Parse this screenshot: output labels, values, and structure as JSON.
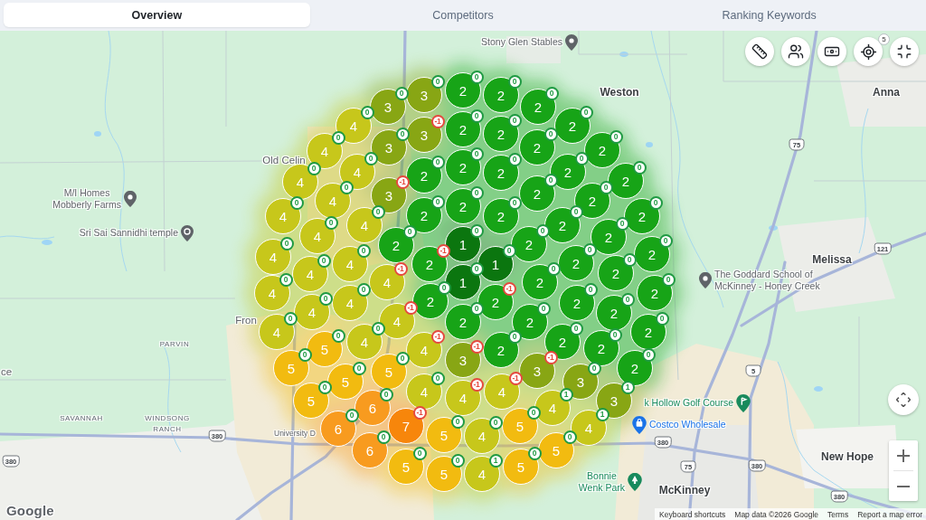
{
  "tabs": [
    {
      "label": "Overview",
      "selected": true
    },
    {
      "label": "Competitors",
      "selected": false
    },
    {
      "label": "Ranking Keywords",
      "selected": false
    }
  ],
  "map_toolbar": {
    "locate_count": "5"
  },
  "map": {
    "places": [
      {
        "text": "Weston",
        "kind": "city"
      },
      {
        "text": "Anna",
        "kind": "city"
      },
      {
        "text": "Old Celin",
        "kind": "locality"
      },
      {
        "text": "Melissa",
        "kind": "city"
      },
      {
        "text": "Fron",
        "kind": "locality"
      },
      {
        "text": "ce",
        "kind": "locality"
      },
      {
        "text": "New Hope",
        "kind": "city"
      },
      {
        "text": "McKinney",
        "kind": "city"
      }
    ],
    "points_of_interest": [
      {
        "lines": [
          "Stony Glen Stables"
        ],
        "color": "#5f6368"
      },
      {
        "lines": [
          "M/I Homes",
          "Mobberly Farms"
        ],
        "color": "#5f6368"
      },
      {
        "lines": [
          "Sri Sai Sannidhi temple"
        ],
        "color": "#5f6368"
      },
      {
        "lines": [
          "The Goddard School of",
          "McKinney - Honey Creek"
        ],
        "color": "#5f6368"
      },
      {
        "lines": [
          "k Hollow Golf Course"
        ],
        "color": "#188a5c"
      },
      {
        "lines": [
          "Costco Wholesale"
        ],
        "color": "#1a73e8"
      },
      {
        "lines": [
          "Bonnie",
          "Wenk Park"
        ],
        "color": "#188a5c"
      }
    ],
    "districts": [
      {
        "lines": [
          "PARVIN"
        ]
      },
      {
        "lines": [
          "SAVANNAH"
        ]
      },
      {
        "lines": [
          "WINDSONG",
          "RANCH"
        ]
      }
    ],
    "road_labels": [
      "University D"
    ],
    "road_shields": [
      "75",
      "121",
      "5",
      "380",
      "380",
      "380",
      "380",
      "75",
      "380"
    ],
    "markers": [
      {
        "rank": "3",
        "color": "#88a614",
        "change": {
          "value": "0",
          "kind": "flat"
        }
      },
      {
        "rank": "3",
        "color": "#88a614",
        "change": {
          "value": "0",
          "kind": "flat"
        }
      },
      {
        "rank": "2",
        "color": "#17a417",
        "change": {
          "value": "0",
          "kind": "flat"
        }
      },
      {
        "rank": "2",
        "color": "#17a417",
        "change": {
          "value": "0",
          "kind": "flat"
        }
      },
      {
        "rank": "2",
        "color": "#17a417",
        "change": {
          "value": "0",
          "kind": "flat"
        }
      },
      {
        "rank": "4",
        "color": "#c7c71b",
        "change": {
          "value": "0",
          "kind": "flat"
        }
      },
      {
        "rank": "3",
        "color": "#88a614",
        "change": {
          "value": "-1",
          "kind": "down"
        }
      },
      {
        "rank": "2",
        "color": "#17a417",
        "change": {
          "value": "0",
          "kind": "flat"
        }
      },
      {
        "rank": "2",
        "color": "#17a417",
        "change": {
          "value": "0",
          "kind": "flat"
        }
      },
      {
        "rank": "2",
        "color": "#17a417",
        "change": {
          "value": "0",
          "kind": "flat"
        }
      },
      {
        "rank": "4",
        "color": "#c7c71b",
        "change": {
          "value": "0",
          "kind": "flat"
        }
      },
      {
        "rank": "3",
        "color": "#88a614",
        "change": {
          "value": "0",
          "kind": "flat"
        }
      },
      {
        "rank": "2",
        "color": "#17a417",
        "change": {
          "value": "0",
          "kind": "flat"
        }
      },
      {
        "rank": "2",
        "color": "#17a417",
        "change": {
          "value": "0",
          "kind": "flat"
        }
      },
      {
        "rank": "4",
        "color": "#c7c71b",
        "change": {
          "value": "0",
          "kind": "flat"
        }
      },
      {
        "rank": "4",
        "color": "#c7c71b",
        "change": {
          "value": "0",
          "kind": "flat"
        }
      },
      {
        "rank": "2",
        "color": "#17a417",
        "change": {
          "value": "0",
          "kind": "flat"
        }
      },
      {
        "rank": "2",
        "color": "#17a417",
        "change": {
          "value": "0",
          "kind": "flat"
        }
      },
      {
        "rank": "2",
        "color": "#17a417",
        "change": {
          "value": "0",
          "kind": "flat"
        }
      },
      {
        "rank": "2",
        "color": "#17a417",
        "change": {
          "value": "0",
          "kind": "flat"
        }
      },
      {
        "rank": "2",
        "color": "#17a417",
        "change": {
          "value": "0",
          "kind": "flat"
        }
      },
      {
        "rank": "4",
        "color": "#c7c71b",
        "change": {
          "value": "0",
          "kind": "flat"
        }
      },
      {
        "rank": "4",
        "color": "#c7c71b",
        "change": {
          "value": "0",
          "kind": "flat"
        }
      },
      {
        "rank": "3",
        "color": "#88a614",
        "change": {
          "value": "-1",
          "kind": "down"
        }
      },
      {
        "rank": "2",
        "color": "#17a417",
        "change": {
          "value": "0",
          "kind": "flat"
        }
      },
      {
        "rank": "2",
        "color": "#17a417",
        "change": {
          "value": "0",
          "kind": "flat"
        }
      },
      {
        "rank": "2",
        "color": "#17a417",
        "change": {
          "value": "0",
          "kind": "flat"
        }
      },
      {
        "rank": "4",
        "color": "#c7c71b",
        "change": {
          "value": "0",
          "kind": "flat"
        }
      },
      {
        "rank": "2",
        "color": "#17a417",
        "change": {
          "value": "0",
          "kind": "flat"
        }
      },
      {
        "rank": "2",
        "color": "#17a417",
        "change": {
          "value": "0",
          "kind": "flat"
        }
      },
      {
        "rank": "2",
        "color": "#17a417",
        "change": {
          "value": "0",
          "kind": "flat"
        }
      },
      {
        "rank": "2",
        "color": "#17a417",
        "change": {
          "value": "0",
          "kind": "flat"
        }
      },
      {
        "rank": "4",
        "color": "#c7c71b",
        "change": {
          "value": "0",
          "kind": "flat"
        }
      },
      {
        "rank": "2",
        "color": "#17a417",
        "change": {
          "value": "0",
          "kind": "flat"
        }
      },
      {
        "rank": "1",
        "color": "#0b760f",
        "change": {
          "value": "0",
          "kind": "flat"
        }
      },
      {
        "rank": "2",
        "color": "#17a417",
        "change": {
          "value": "0",
          "kind": "flat"
        }
      },
      {
        "rank": "2",
        "color": "#17a417",
        "change": {
          "value": "0",
          "kind": "flat"
        }
      },
      {
        "rank": "4",
        "color": "#c7c71b",
        "change": {
          "value": "0",
          "kind": "flat"
        }
      },
      {
        "rank": "4",
        "color": "#c7c71b",
        "change": {
          "value": "0",
          "kind": "flat"
        }
      },
      {
        "rank": "2",
        "color": "#17a417",
        "change": {
          "value": "-1",
          "kind": "down"
        }
      },
      {
        "rank": "1",
        "color": "#0b760f",
        "change": {
          "value": "0",
          "kind": "flat"
        }
      },
      {
        "rank": "2",
        "color": "#17a417",
        "change": {
          "value": "0",
          "kind": "flat"
        }
      },
      {
        "rank": "2",
        "color": "#17a417",
        "change": {
          "value": "0",
          "kind": "flat"
        }
      },
      {
        "rank": "4",
        "color": "#c7c71b",
        "change": {
          "value": "0",
          "kind": "flat"
        }
      },
      {
        "rank": "4",
        "color": "#c7c71b",
        "change": {
          "value": "-1",
          "kind": "down"
        }
      },
      {
        "rank": "1",
        "color": "#0b760f",
        "change": {
          "value": "0",
          "kind": "flat"
        }
      },
      {
        "rank": "2",
        "color": "#17a417",
        "change": {
          "value": "0",
          "kind": "flat"
        }
      },
      {
        "rank": "2",
        "color": "#17a417",
        "change": {
          "value": "0",
          "kind": "flat"
        }
      },
      {
        "rank": "4",
        "color": "#c7c71b",
        "change": {
          "value": "0",
          "kind": "flat"
        }
      },
      {
        "rank": "4",
        "color": "#c7c71b",
        "change": {
          "value": "0",
          "kind": "flat"
        }
      },
      {
        "rank": "2",
        "color": "#17a417",
        "change": {
          "value": "0",
          "kind": "flat"
        }
      },
      {
        "rank": "2",
        "color": "#17a417",
        "change": {
          "value": "-1",
          "kind": "down"
        }
      },
      {
        "rank": "2",
        "color": "#17a417",
        "change": {
          "value": "0",
          "kind": "flat"
        }
      },
      {
        "rank": "2",
        "color": "#17a417",
        "change": {
          "value": "0",
          "kind": "flat"
        }
      },
      {
        "rank": "4",
        "color": "#c7c71b",
        "change": {
          "value": "0",
          "kind": "flat"
        }
      },
      {
        "rank": "4",
        "color": "#c7c71b",
        "change": {
          "value": "-1",
          "kind": "down"
        }
      },
      {
        "rank": "2",
        "color": "#17a417",
        "change": {
          "value": "0",
          "kind": "flat"
        }
      },
      {
        "rank": "2",
        "color": "#17a417",
        "change": {
          "value": "0",
          "kind": "flat"
        }
      },
      {
        "rank": "2",
        "color": "#17a417",
        "change": {
          "value": "0",
          "kind": "flat"
        }
      },
      {
        "rank": "4",
        "color": "#c7c71b",
        "change": {
          "value": "0",
          "kind": "flat"
        }
      },
      {
        "rank": "5",
        "color": "#f2bb10",
        "change": {
          "value": "0",
          "kind": "flat"
        }
      },
      {
        "rank": "4",
        "color": "#c7c71b",
        "change": {
          "value": "0",
          "kind": "flat"
        }
      },
      {
        "rank": "4",
        "color": "#c7c71b",
        "change": {
          "value": "-1",
          "kind": "down"
        }
      },
      {
        "rank": "2",
        "color": "#17a417",
        "change": {
          "value": "0",
          "kind": "flat"
        }
      },
      {
        "rank": "2",
        "color": "#17a417",
        "change": {
          "value": "0",
          "kind": "flat"
        }
      },
      {
        "rank": "2",
        "color": "#17a417",
        "change": {
          "value": "0",
          "kind": "flat"
        }
      },
      {
        "rank": "2",
        "color": "#17a417",
        "change": {
          "value": "0",
          "kind": "flat"
        }
      },
      {
        "rank": "5",
        "color": "#f2bb10",
        "change": {
          "value": "0",
          "kind": "flat"
        }
      },
      {
        "rank": "5",
        "color": "#f2bb10",
        "change": {
          "value": "0",
          "kind": "flat"
        }
      },
      {
        "rank": "5",
        "color": "#f2bb10",
        "change": {
          "value": "0",
          "kind": "flat"
        }
      },
      {
        "rank": "3",
        "color": "#88a614",
        "change": {
          "value": "-1",
          "kind": "down"
        }
      },
      {
        "rank": "3",
        "color": "#88a614",
        "change": {
          "value": "-1",
          "kind": "down"
        }
      },
      {
        "rank": "3",
        "color": "#88a614",
        "change": {
          "value": "0",
          "kind": "flat"
        }
      },
      {
        "rank": "2",
        "color": "#17a417",
        "change": {
          "value": "0",
          "kind": "flat"
        }
      },
      {
        "rank": "5",
        "color": "#f2bb10",
        "change": {
          "value": "0",
          "kind": "flat"
        }
      },
      {
        "rank": "6",
        "color": "#f89b1f",
        "change": {
          "value": "0",
          "kind": "flat"
        }
      },
      {
        "rank": "4",
        "color": "#c7c71b",
        "change": {
          "value": "0",
          "kind": "flat"
        }
      },
      {
        "rank": "4",
        "color": "#c7c71b",
        "change": {
          "value": "-1",
          "kind": "down"
        }
      },
      {
        "rank": "4",
        "color": "#c7c71b",
        "change": {
          "value": "-1",
          "kind": "down"
        }
      },
      {
        "rank": "4",
        "color": "#c7c71b",
        "change": {
          "value": "1",
          "kind": "up"
        }
      },
      {
        "rank": "3",
        "color": "#88a614",
        "change": {
          "value": "1",
          "kind": "up"
        }
      },
      {
        "rank": "6",
        "color": "#f89b1f",
        "change": {
          "value": "0",
          "kind": "flat"
        }
      },
      {
        "rank": "7",
        "color": "#f7860b",
        "change": {
          "value": "-1",
          "kind": "down"
        }
      },
      {
        "rank": "5",
        "color": "#f2bb10",
        "change": {
          "value": "0",
          "kind": "flat"
        }
      },
      {
        "rank": "4",
        "color": "#c7c71b",
        "change": {
          "value": "0",
          "kind": "flat"
        }
      },
      {
        "rank": "5",
        "color": "#f2bb10",
        "change": {
          "value": "0",
          "kind": "flat"
        }
      },
      {
        "rank": "4",
        "color": "#c7c71b",
        "change": {
          "value": "1",
          "kind": "up"
        }
      },
      {
        "rank": "6",
        "color": "#f89b1f",
        "change": {
          "value": "0",
          "kind": "flat"
        }
      },
      {
        "rank": "5",
        "color": "#f2bb10",
        "change": {
          "value": "0",
          "kind": "flat"
        }
      },
      {
        "rank": "5",
        "color": "#f2bb10",
        "change": {
          "value": "0",
          "kind": "flat"
        }
      },
      {
        "rank": "4",
        "color": "#c7c71b",
        "change": {
          "value": "1",
          "kind": "up"
        }
      },
      {
        "rank": "5",
        "color": "#f2bb10",
        "change": {
          "value": "0",
          "kind": "flat"
        }
      },
      {
        "rank": "5",
        "color": "#f2bb10",
        "change": {
          "value": "0",
          "kind": "flat"
        }
      }
    ]
  },
  "attribution": {
    "logo": "Google",
    "items": [
      "Keyboard shortcuts",
      "Map data ©2026 Google",
      "Terms",
      "Report a map error"
    ]
  }
}
